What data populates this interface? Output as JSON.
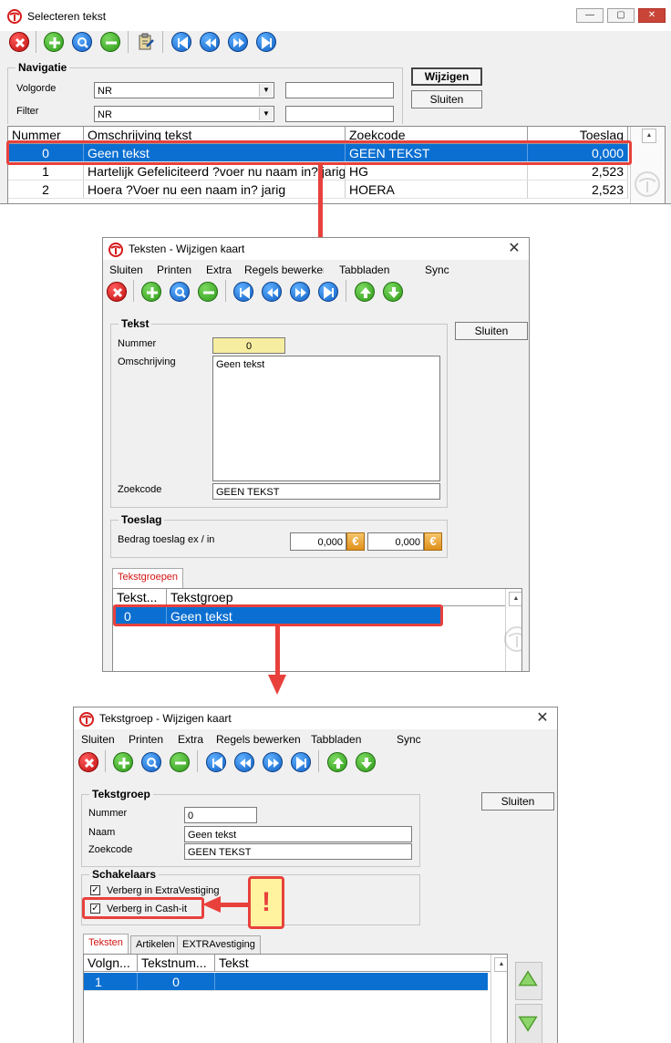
{
  "window1": {
    "title": "Selecteren tekst",
    "navigation": {
      "title": "Navigatie",
      "volgorde_label": "Volgorde",
      "volgorde_value": "NR",
      "filter_label": "Filter",
      "filter_value": "NR"
    },
    "buttons": {
      "wijzigen": "Wijzigen",
      "sluiten": "Sluiten"
    },
    "grid": {
      "headers": [
        "Nummer",
        "Omschrijving tekst",
        "Zoekcode",
        "Toeslag"
      ],
      "rows": [
        {
          "nummer": "0",
          "omschrijving": "Geen tekst",
          "zoekcode": "GEEN TEKST",
          "toeslag": "0,000"
        },
        {
          "nummer": "1",
          "omschrijving": "Hartelijk Gefeliciteerd ?voer nu naam in? jarig",
          "zoekcode": "HG",
          "toeslag": "2,523"
        },
        {
          "nummer": "2",
          "omschrijving": "Hoera ?Voer nu een naam in? jarig",
          "zoekcode": "HOERA",
          "toeslag": "2,523"
        }
      ]
    }
  },
  "window2": {
    "title": "Teksten - Wijzigen kaart",
    "menu": [
      "Sluiten",
      "Printen",
      "Extra",
      "Regels bewerken",
      "Tabbladen",
      "Sync"
    ],
    "tekst": {
      "title": "Tekst",
      "nummer_label": "Nummer",
      "nummer_value": "0",
      "omschrijving_label": "Omschrijving",
      "omschrijving_value": "Geen tekst",
      "zoekcode_label": "Zoekcode",
      "zoekcode_value": "GEEN TEKST"
    },
    "toeslag": {
      "title": "Toeslag",
      "bedrag_label": "Bedrag toeslag ex / in",
      "ex_value": "0,000",
      "in_value": "0,000",
      "currency": "€"
    },
    "sluiten_button": "Sluiten",
    "tab": "Tekstgroepen",
    "grid": {
      "headers": [
        "Tekst...",
        "Tekstgroep"
      ],
      "rows": [
        {
          "tekst": "0",
          "tekstgroep": "Geen tekst"
        }
      ]
    }
  },
  "window3": {
    "title": "Tekstgroep - Wijzigen kaart",
    "menu": [
      "Sluiten",
      "Printen",
      "Extra",
      "Regels bewerken",
      "Tabbladen",
      "Sync"
    ],
    "tekstgroep": {
      "title": "Tekstgroep",
      "nummer_label": "Nummer",
      "nummer_value": "0",
      "naam_label": "Naam",
      "naam_value": "Geen tekst",
      "zoekcode_label": "Zoekcode",
      "zoekcode_value": "GEEN TEKST"
    },
    "schakelaars": {
      "title": "Schakelaars",
      "items": [
        {
          "label": "Verberg in ExtraVestiging",
          "checked": "✓"
        },
        {
          "label": "Verberg in Cash-it",
          "checked": "✓"
        }
      ]
    },
    "sluiten_button": "Sluiten",
    "tabs": [
      "Teksten",
      "Artikelen",
      "EXTRAvestiging"
    ],
    "grid": {
      "headers": [
        "Volgn...",
        "Tekstnum...",
        "Tekst"
      ],
      "rows": [
        {
          "volgnummer": "1",
          "tekstnummer": "0",
          "tekst": ""
        }
      ]
    }
  },
  "annotation": {
    "symbol": "!"
  },
  "colors": {
    "highlight": "#e8413c",
    "selection": "#0b6fd1",
    "warning_bg": "#fff3a0"
  }
}
